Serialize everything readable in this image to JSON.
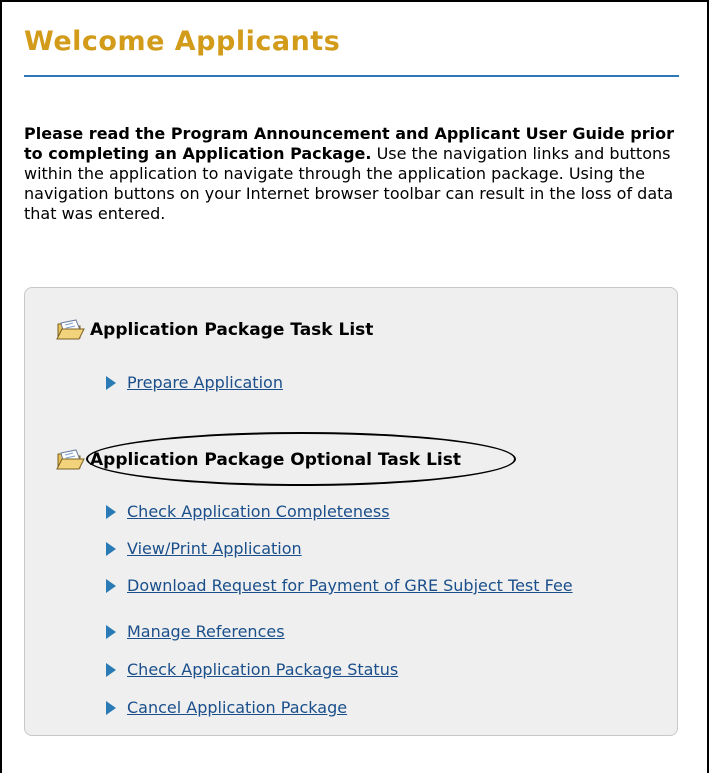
{
  "page": {
    "title": "Welcome Applicants"
  },
  "intro": {
    "bold_text": "Please read the Program Announcement and Applicant User Guide prior to completing an Application Package.",
    "body_text": " Use the navigation links and buttons within the application to navigate through the application package. Using the navigation buttons on your Internet browser toolbar can result in the loss of data that was entered."
  },
  "task_list": {
    "header": "Application Package Task List",
    "items": [
      {
        "label": "Prepare Application"
      }
    ]
  },
  "optional_task_list": {
    "header": "Application Package Optional Task List",
    "items": [
      {
        "label": "Check Application Completeness"
      },
      {
        "label": "View/Print Application"
      },
      {
        "label": "Download Request for Payment of GRE Subject Test Fee"
      },
      {
        "label": "Manage References"
      },
      {
        "label": "Check Application Package Status"
      },
      {
        "label": "Cancel Application Package"
      }
    ]
  },
  "colors": {
    "title": "#d29b1a",
    "rule": "#2f78b8",
    "link": "#1a4f8b",
    "arrow": "#2a7ab5",
    "panel": "#efefef"
  },
  "icons": {
    "section": "open-folder-icon",
    "item": "triangle-arrow-icon"
  }
}
